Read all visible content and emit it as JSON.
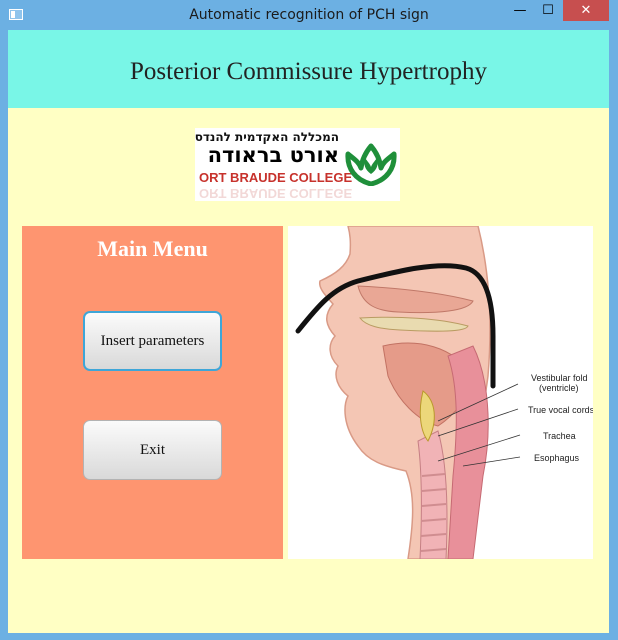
{
  "window": {
    "title": "Automatic recognition of PCH sign",
    "minimize_glyph": "—",
    "maximize_glyph": "☐",
    "close_glyph": "✕"
  },
  "header": {
    "title": "Posterior Commissure Hypertrophy"
  },
  "logo": {
    "hebrew_tagline": "המכללה האקדמית להנדסה",
    "hebrew_name": "אורט בראודה",
    "english_name": "ORT BRAUDE COLLEGE",
    "emblem_color": "#1f8f3a"
  },
  "menu": {
    "title": "Main Menu",
    "insert_label": "Insert parameters",
    "exit_label": "Exit"
  },
  "illustration": {
    "labels": {
      "vestibular_fold": "Vestibular fold",
      "ventricle": "(ventricle)",
      "true_vocal_cords": "True vocal cords",
      "trachea": "Trachea",
      "esophagus": "Esophagus"
    }
  },
  "colors": {
    "header_band": "#79f6e7",
    "background": "#ffffc4",
    "menu_panel": "#fe9570",
    "close_button": "#c74f4f"
  }
}
